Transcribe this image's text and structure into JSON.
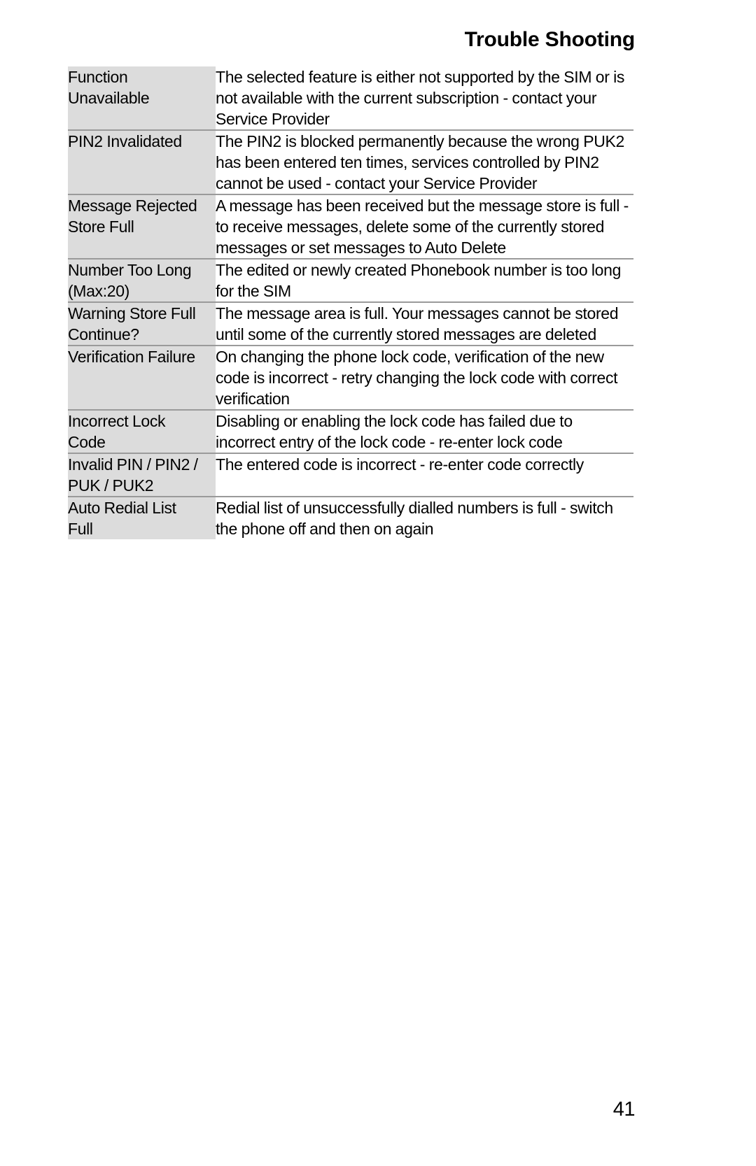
{
  "header": {
    "title": "Trouble Shooting"
  },
  "table": {
    "rows": [
      {
        "term": "Function\nUnavailable",
        "description": "The selected feature is either not supported by the SIM or is not available with the current subscription - contact your Service Provider"
      },
      {
        "term": "PIN2 Invalidated",
        "description": "The PIN2 is blocked permanently because the wrong PUK2 has been entered ten times, services controlled by PIN2 cannot be used - contact your Service Provider"
      },
      {
        "term": "Message Rejected\nStore Full",
        "description": "A message has been received but the message store is full - to receive messages, delete some of the currently stored messages or set messages to Auto Delete"
      },
      {
        "term": "Number Too Long\n(Max:20)",
        "description": "The edited or newly created Phonebook number is too long for the SIM"
      },
      {
        "term": "Warning Store Full\nContinue?",
        "description": "The message area is full. Your messages cannot be stored until some of the currently stored messages are deleted"
      },
      {
        "term": "Verification Failure",
        "description": "On changing the phone lock code, verification of the new code is incorrect - retry changing the lock code with correct verification"
      },
      {
        "term": "Incorrect Lock\nCode",
        "description": "Disabling or enabling the lock code has failed due to incorrect entry of the lock code - re-enter lock code"
      },
      {
        "term": "Invalid PIN / PIN2 /\nPUK / PUK2",
        "description": "The entered code is incorrect - re-enter code correctly"
      },
      {
        "term": "Auto Redial List\nFull",
        "description": "Redial list of unsuccessfully dialled numbers is full - switch the phone off and then on again"
      }
    ]
  },
  "footer": {
    "page_number": "41"
  },
  "colors": {
    "term_cell_background": "#dcdcdc",
    "rule": "#9a9a9a",
    "text": "#000000",
    "page_background": "#ffffff"
  }
}
